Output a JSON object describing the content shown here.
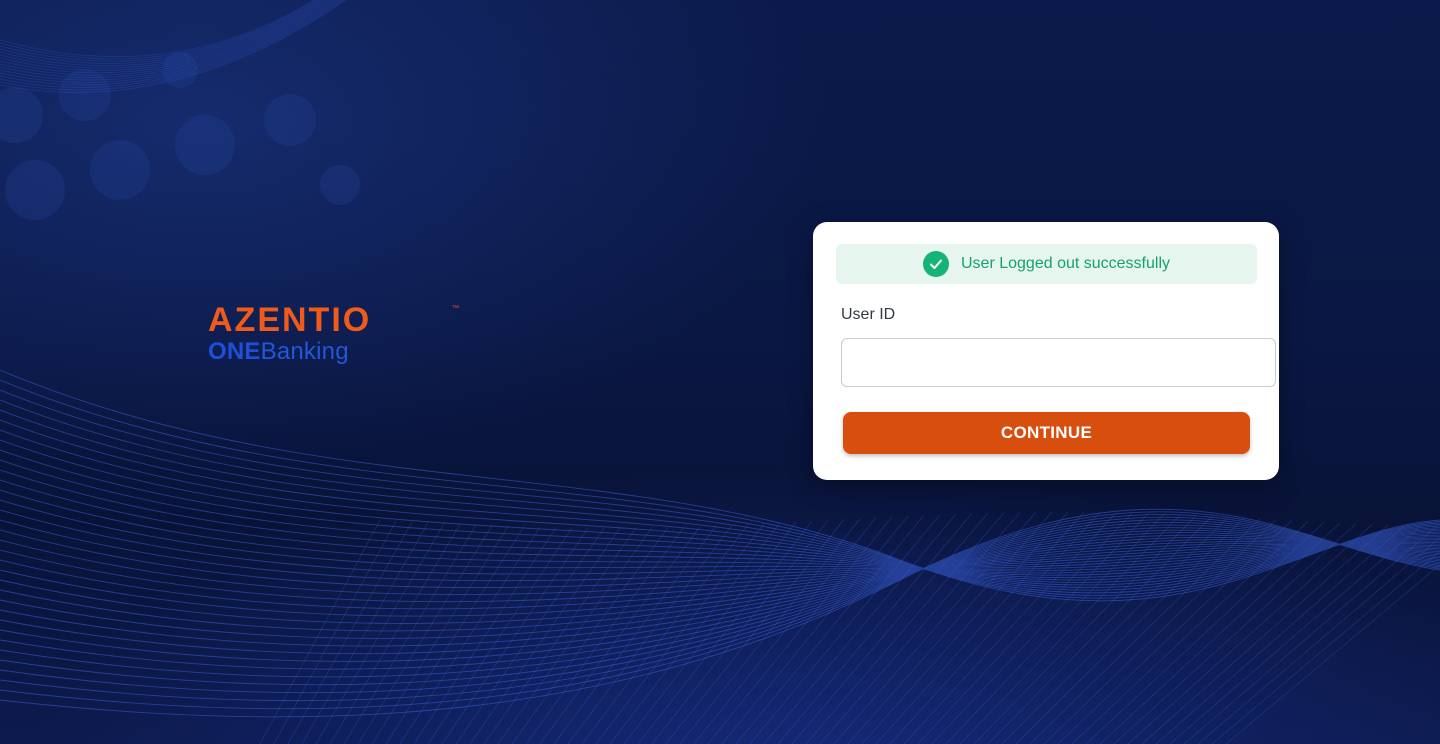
{
  "brand": {
    "logo_text": "AZENTIO",
    "trademark": "™",
    "product_prefix": "ONE",
    "product_suffix": "Banking",
    "logo_color": "#f05a1a",
    "product_color": "#1f4fd8"
  },
  "alert": {
    "icon": "check-circle-icon",
    "message": "User Logged out successfully",
    "color": "#13a36c",
    "background": "#e6f6ef"
  },
  "login": {
    "user_id_label": "User ID",
    "user_id_value": "",
    "continue_label": "CONTINUE",
    "button_color": "#d84e0f"
  },
  "theme": {
    "background": "#0a1743"
  }
}
